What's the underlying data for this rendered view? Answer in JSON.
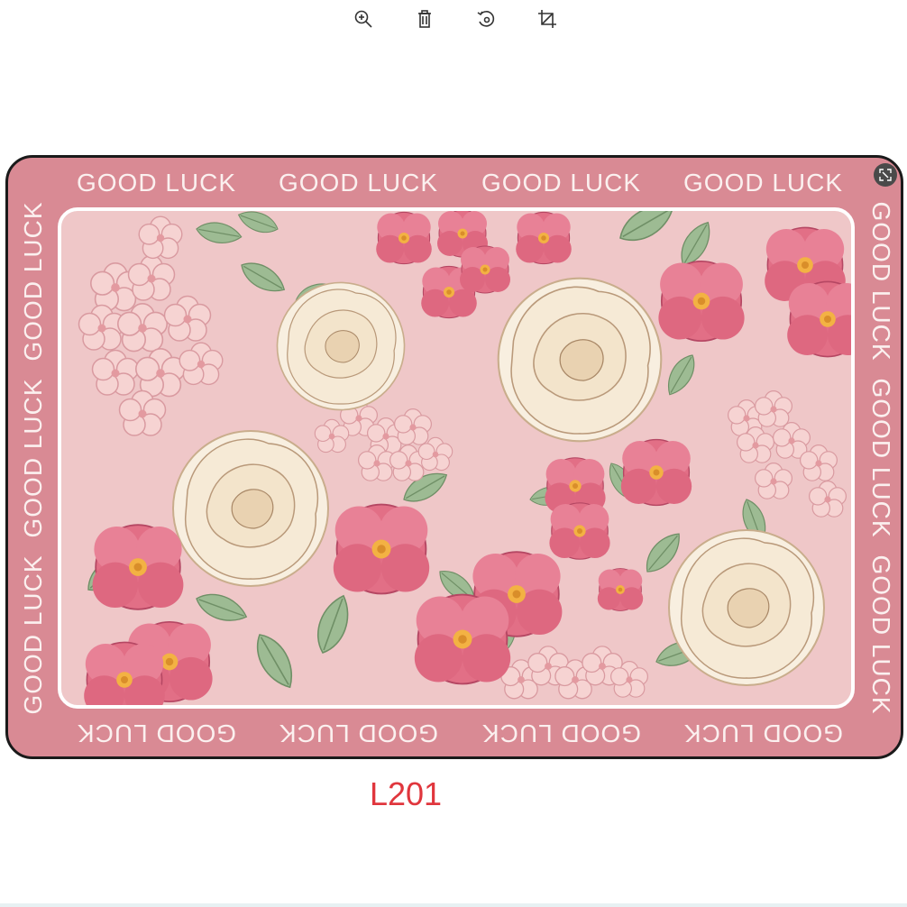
{
  "toolbar": {
    "zoom_icon": "zoom-in-icon",
    "delete_icon": "trash-icon",
    "rotate_icon": "rotate-icon",
    "crop_icon": "crop-icon"
  },
  "mat": {
    "border_text": "GOOD LUCK",
    "colors": {
      "border": "#d98a94",
      "inner": "#efc7c8",
      "text": "#fbf0ef",
      "outline": "#1a1a1a"
    },
    "expand_icon": "expand-icon"
  },
  "product_code": "L201",
  "colors": {
    "code": "#e0363d"
  }
}
